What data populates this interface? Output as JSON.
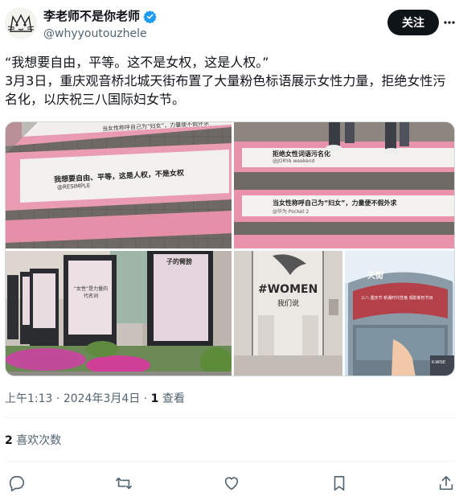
{
  "author": {
    "name": "李老师不是你老师",
    "handle": "@whyyoutouzhele"
  },
  "follow_label": "关注",
  "tweet": {
    "text": "“我想要自由，平等。这不是女权，这是人权。”\n3月3日，重庆观音桥北城天街布置了大量粉色标语展示女性力量，拒绝女性污名化，以庆祝三八国际妇女节。"
  },
  "media": {
    "photo1": {
      "banner_main": "我想要自由、平等，这是人权，不是女权",
      "banner_credit": "@RESIMPLE",
      "banner_top": "当女性称呼自己为“妇女”，力量便不假外求"
    },
    "photo2": {
      "banner_main": "拒绝女性词语污名化",
      "banner_credit": "@JORYA weekend",
      "banner_bottom": "当女性称呼自己为“妇女”，力量便不假外求",
      "banner_credit2": "@华为 Pocket 2"
    },
    "photo3": {
      "screen_text": "子的臂膀",
      "screen_text2": "“女性”是力量的代名词"
    },
    "photo4": {
      "poster_title": "#WOMEN",
      "poster_sub": "我们说"
    },
    "photo5": {
      "mall_name": "天街",
      "screen_text": "三八·重庆节 新潮时代性格 观影新形节目",
      "kiosk_text": "K-WISE"
    }
  },
  "meta": {
    "time": "上午1:13",
    "dot": "·",
    "date": "2024年3月4日",
    "views_count": "1",
    "views_label": "查看"
  },
  "likes": {
    "count": "2",
    "label": "喜欢次数"
  }
}
